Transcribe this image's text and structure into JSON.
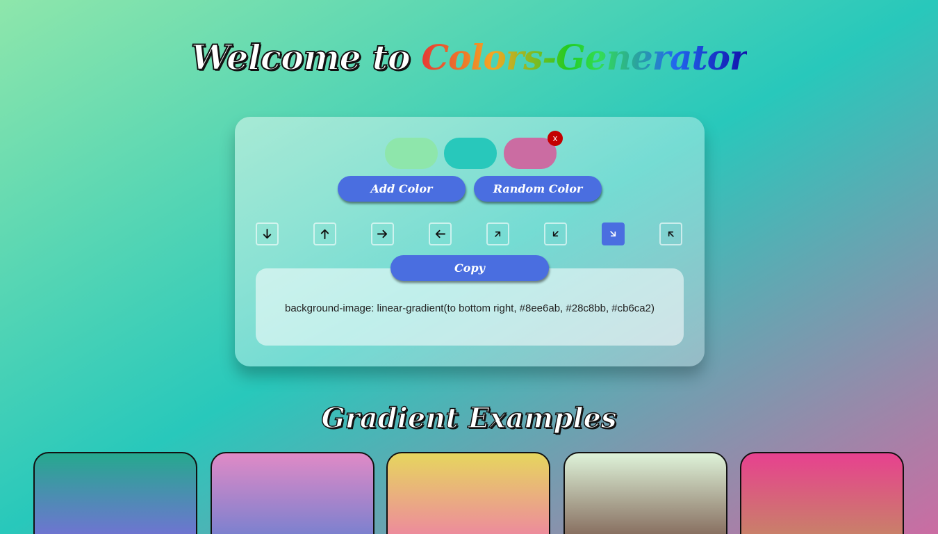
{
  "header": {
    "welcome_text": "Welcome to ",
    "brand_text": "Colors-Generator"
  },
  "colors": {
    "swatches": [
      "#8ee6ab",
      "#28c8bb",
      "#cb6ca2"
    ],
    "remove_label": "x",
    "accent": "#4a6ee0"
  },
  "buttons": {
    "add_color": "Add Color",
    "random_color": "Random Color",
    "copy": "Copy"
  },
  "directions": [
    {
      "icon": "arrow-down-icon",
      "value": "to bottom",
      "active": false
    },
    {
      "icon": "arrow-up-icon",
      "value": "to top",
      "active": false
    },
    {
      "icon": "arrow-right-icon",
      "value": "to right",
      "active": false
    },
    {
      "icon": "arrow-left-icon",
      "value": "to left",
      "active": false
    },
    {
      "icon": "arrow-up-right-icon",
      "value": "to top right",
      "active": false
    },
    {
      "icon": "arrow-down-left-icon",
      "value": "to bottom left",
      "active": false
    },
    {
      "icon": "arrow-down-right-icon",
      "value": "to bottom right",
      "active": true
    },
    {
      "icon": "arrow-up-left-icon",
      "value": "to top left",
      "active": false
    }
  ],
  "output": {
    "css_text": "background-image: linear-gradient(to bottom right, #8ee6ab, #28c8bb, #cb6ca2)"
  },
  "examples": {
    "title": "Gradient Examples",
    "cards": [
      {
        "colors": [
          "#25a98e",
          "#7a6cdc"
        ]
      },
      {
        "colors": [
          "#e08ac6",
          "#6c7fd0"
        ]
      },
      {
        "colors": [
          "#e6d65e",
          "#ee7fa6"
        ]
      },
      {
        "colors": [
          "#def3d9",
          "#7a5a4d"
        ]
      },
      {
        "colors": [
          "#e7418f",
          "#c48a63"
        ]
      }
    ]
  }
}
